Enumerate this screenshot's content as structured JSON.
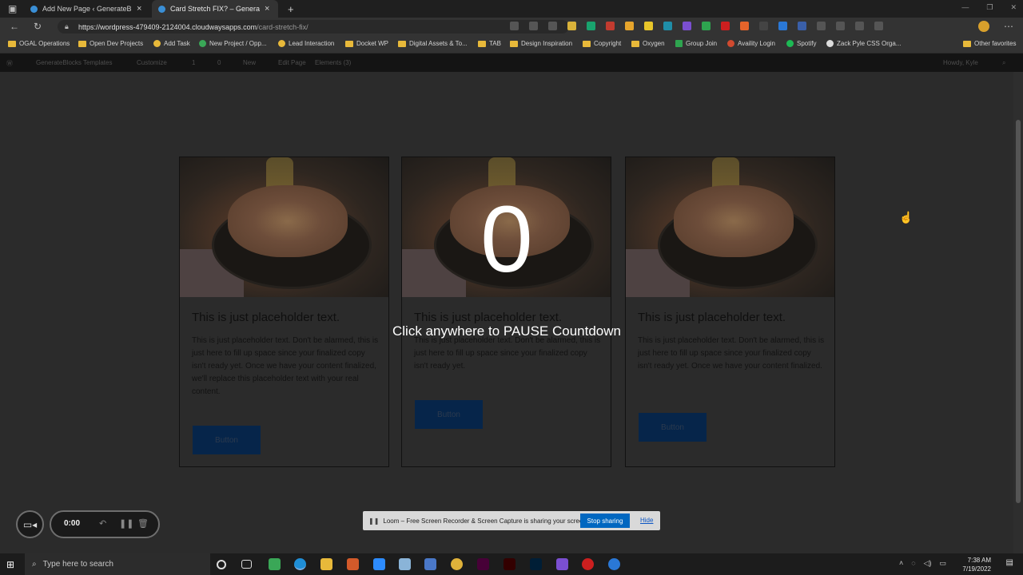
{
  "browser": {
    "tabs": [
      {
        "title": "Add New Page ‹ GenerateBlocks",
        "active": false
      },
      {
        "title": "Card Stretch FIX? – GenerateBlocks",
        "active": true
      }
    ],
    "new_tab": "+",
    "url_host": "https://wordpress-479409-2124004.cloudwaysapps.com",
    "url_path": "/card-stretch-fix/",
    "bookmarks": [
      "OGAL Operations",
      "Open Dev Projects",
      "Add Task",
      "New Project / Opp...",
      "Lead Interaction",
      "Docket WP",
      "Digital Assets & To...",
      "TAB",
      "Design Inspiration",
      "Copyright",
      "Oxygen",
      "Group Join",
      "Availity Login",
      "Spotify",
      "Zack Pyle CSS Orga...",
      "Other favorites"
    ]
  },
  "wp_admin_bar": {
    "site": "GenerateBlocks Templates",
    "customize": "Customize",
    "updates": "1",
    "comments": "0",
    "new": "New",
    "edit_page": "Edit Page",
    "elements": "Elements (3)",
    "howdy": "Howdy, Kyle"
  },
  "cards": [
    {
      "title": "This is just placeholder text.",
      "body": "This is just placeholder text. Don't be alarmed, this is just here to fill up space since your finalized copy isn't ready yet. Once we have your content finalized, we'll replace this placeholder text with your real content.",
      "button": "Button"
    },
    {
      "title": "This is just placeholder text.",
      "body": "This is just placeholder text. Don't be alarmed, this is just here to fill up space since your finalized copy isn't ready yet.",
      "button": "Button"
    },
    {
      "title": "This is just placeholder text.",
      "body": "This is just placeholder text. Don't be alarmed, this is just here to fill up space since your finalized copy isn't ready yet. Once we have your content finalized.",
      "button": "Button"
    }
  ],
  "countdown": {
    "number": "0",
    "message": "Click anywhere to PAUSE Countdown"
  },
  "recorder": {
    "time": "0:00"
  },
  "loom": {
    "message": "Loom – Free Screen Recorder & Screen Capture is sharing your screen.",
    "stop": "Stop sharing",
    "hide": "Hide"
  },
  "taskbar": {
    "search_placeholder": "Type here to search",
    "time": "7:38 AM",
    "date": "7/19/2022"
  },
  "colors": {
    "button_bg": "#06254a",
    "stop_btn": "#0067c0",
    "page_bg": "#2b2b2b"
  }
}
